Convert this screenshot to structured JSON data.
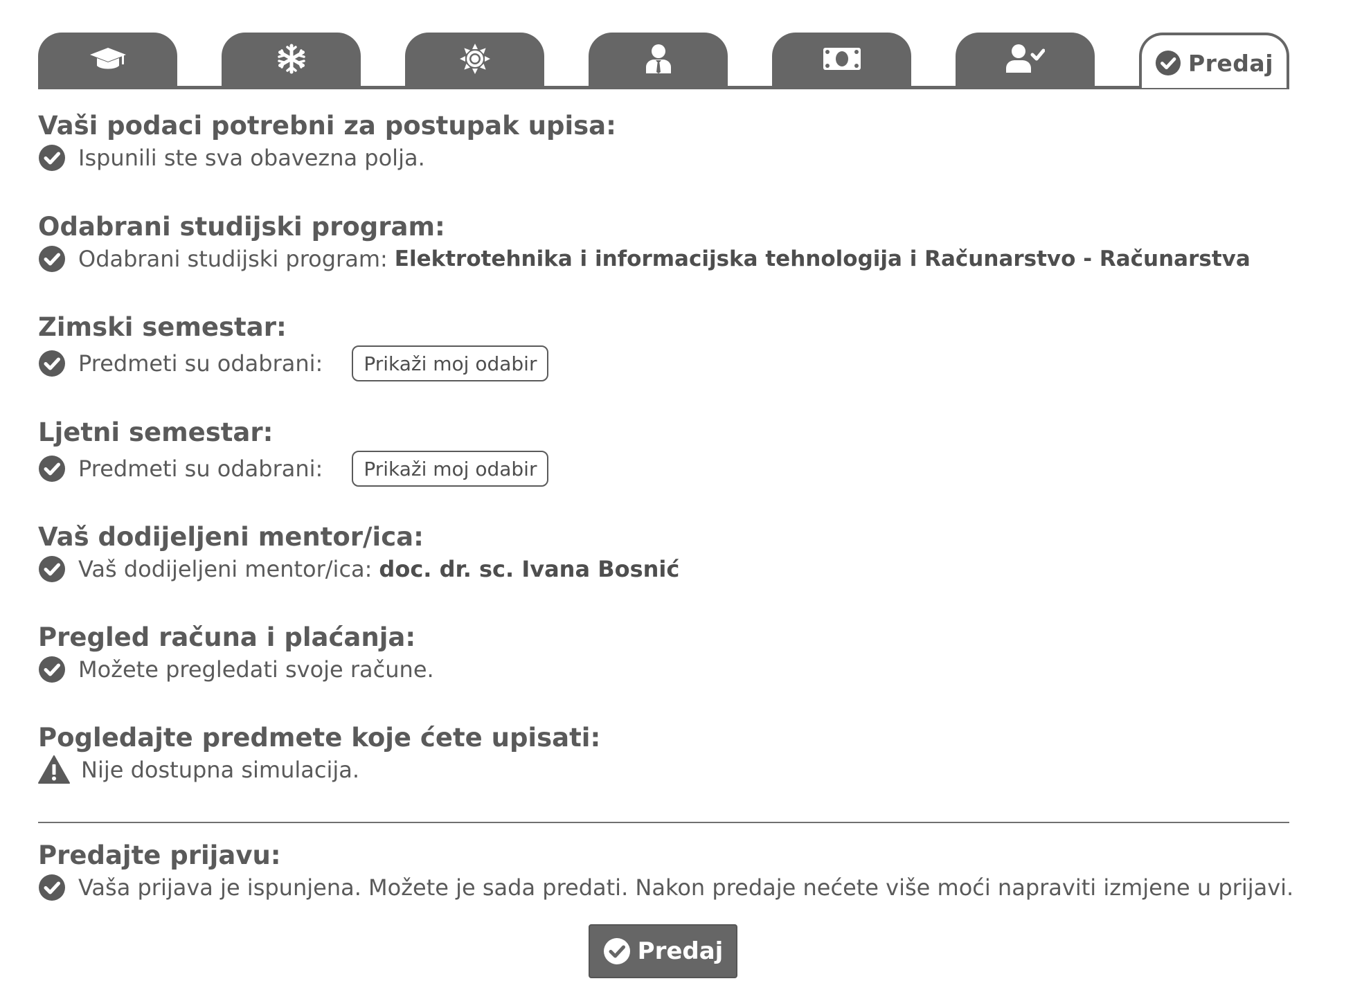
{
  "colors": {
    "tab_bg": "#666666",
    "text": "#5a5a5a",
    "button_bg": "#666666",
    "button_text": "#ffffff"
  },
  "tabs": [
    {
      "icon": "graduation-cap-icon"
    },
    {
      "icon": "snowflake-icon"
    },
    {
      "icon": "sun-icon"
    },
    {
      "icon": "mentor-icon"
    },
    {
      "icon": "money-icon"
    },
    {
      "icon": "user-check-icon"
    },
    {
      "icon": "check-circle-icon",
      "label": "Predaj",
      "active": true
    }
  ],
  "sections": {
    "personal": {
      "title": "Vaši podaci potrebni za postupak upisa:",
      "status": "Ispunili ste sva obavezna polja.",
      "icon": "check-circle-icon"
    },
    "program": {
      "title": "Odabrani studijski program:",
      "status": "Odabrani studijski program:",
      "value": "Elektrotehnika i informacijska tehnologija i Računarstvo - Računarstva",
      "icon": "check-circle-icon"
    },
    "winter": {
      "title": "Zimski semestar:",
      "status": "Predmeti su odabrani:",
      "button": "Prikaži moj odabir",
      "icon": "check-circle-icon"
    },
    "summer": {
      "title": "Ljetni semestar:",
      "status": "Predmeti su odabrani:",
      "button": "Prikaži moj odabir",
      "icon": "check-circle-icon"
    },
    "mentor": {
      "title": "Vaš dodijeljeni mentor/ica:",
      "status": "Vaš dodijeljeni mentor/ica:",
      "value": "doc. dr. sc. Ivana Bosnić",
      "icon": "check-circle-icon"
    },
    "payments": {
      "title": "Pregled računa i plaćanja:",
      "status": "Možete pregledati svoje račune.",
      "icon": "check-circle-icon"
    },
    "simulation": {
      "title": "Pogledajte predmete koje ćete upisati:",
      "status": "Nije dostupna simulacija.",
      "icon": "warning-icon"
    },
    "submit": {
      "title": "Predajte prijavu:",
      "status": "Vaša prijava je ispunjena. Možete je sada predati. Nakon predaje nećete više moći napraviti izmjene u prijavi.",
      "icon": "check-circle-icon"
    }
  },
  "submit_button": {
    "label": "Predaj",
    "icon": "check-circle-icon"
  }
}
